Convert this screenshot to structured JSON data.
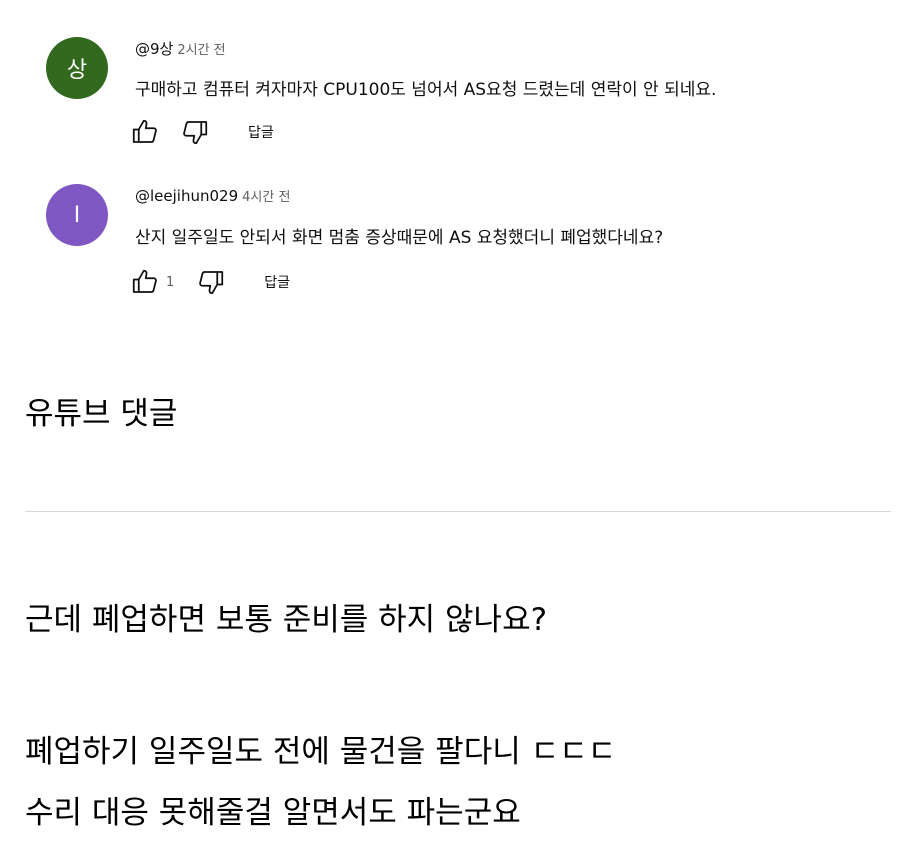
{
  "comments": [
    {
      "avatar_letter": "상",
      "avatar_color": "#33691e",
      "author": "@9상",
      "time": "2시간 전",
      "text": "구매하고 컴퓨터 켜자마자 CPU100도 넘어서 AS요청 드렸는데 연락이 안 되네요.",
      "like_count": "",
      "reply_label": "답글"
    },
    {
      "avatar_letter": "I",
      "avatar_color": "#7e57c2",
      "author": "@leejihun029",
      "time": "4시간 전",
      "text": "산지 일주일도 안되서 화면 멈춤 증상때문에 AS 요청했더니 폐업했다네요?",
      "like_count": "1",
      "reply_label": "답글"
    }
  ],
  "post": {
    "caption": "유튜브 댓글",
    "line1": "근데 폐업하면 보통 준비를 하지 않나요?",
    "line2": "폐업하기 일주일도 전에 물건을 팔다니 ㄷㄷㄷ",
    "line3": "수리 대응 못해줄걸 알면서도 파는군요"
  },
  "icons": {
    "like": "thumbs-up-icon",
    "dislike": "thumbs-down-icon"
  }
}
